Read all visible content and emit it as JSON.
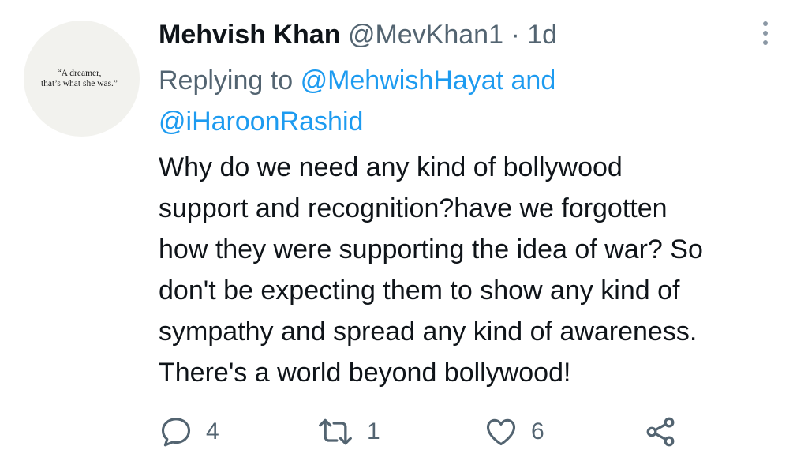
{
  "tweet": {
    "avatar_quote": "“A dreamer,\nthat’s what she was.”",
    "display_name": "Mehvish Khan",
    "handle": "@MevKhan1",
    "separator": "·",
    "time": "1d",
    "replying_prefix": "Replying to",
    "mention_1": "@MehwishHayat",
    "replying_and": "and",
    "mention_2": "@iHaroonRashid",
    "body_lines": [
      "Why do we need any kind of bollywood",
      "support and recognition?have we forgotten",
      "how they were supporting the idea of war? So",
      "don't be expecting them to show any kind of",
      "sympathy and spread any kind of awareness.",
      "There's a world beyond bollywood!"
    ]
  },
  "actions": {
    "reply_count": "4",
    "retweet_count": "1",
    "like_count": "6"
  },
  "icons": {
    "reply": "reply-icon",
    "retweet": "retweet-icon",
    "like": "heart-icon",
    "share": "share-icon",
    "more": "more-vertical-icon"
  },
  "colors": {
    "mention": "#1d9bf0",
    "muted": "#536471",
    "text": "#0f1419"
  }
}
